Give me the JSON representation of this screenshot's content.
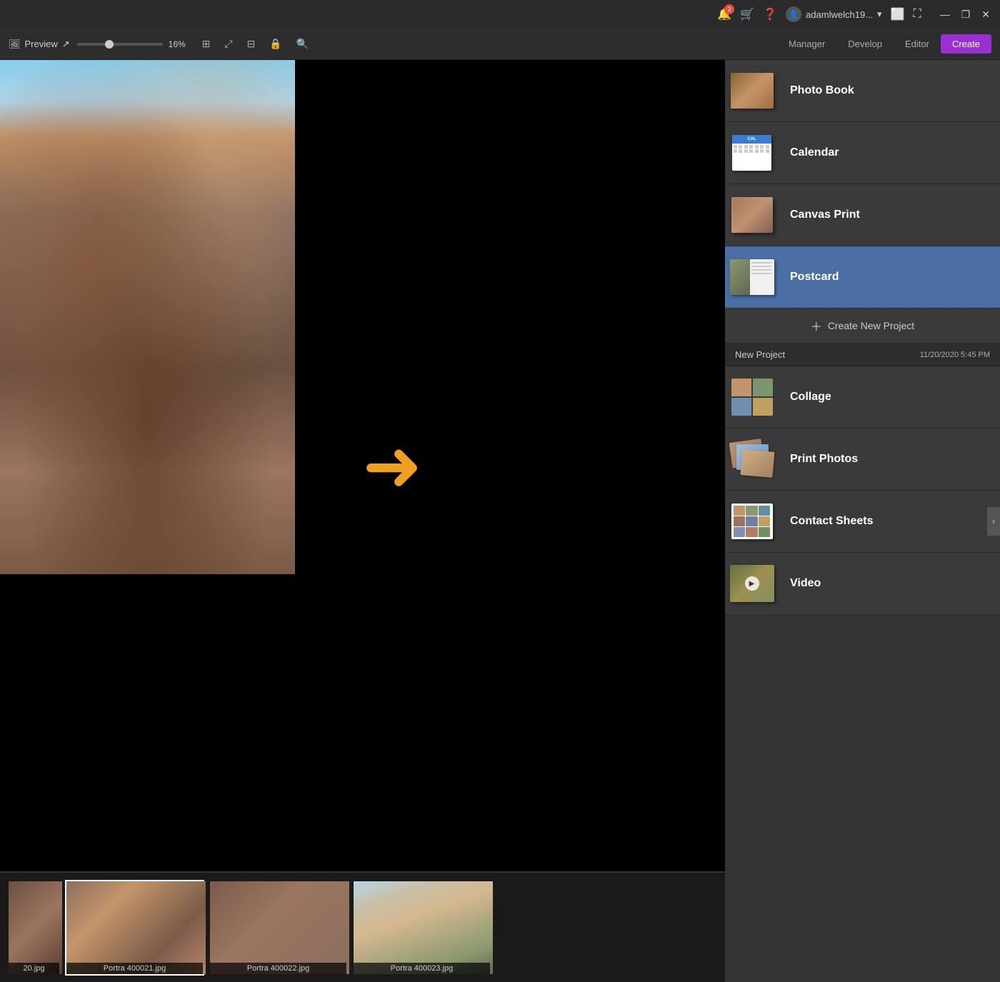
{
  "titlebar": {
    "notification_count": "2",
    "username": "adamlwelch19...",
    "monitor_icon": "⬜",
    "fullscreen_icon": "⛶",
    "minimize": "—",
    "restore": "❐",
    "close": "✕"
  },
  "toolbar": {
    "preview_label": "Preview",
    "zoom_percent": "16%",
    "nav": {
      "manager": "Manager",
      "develop": "Develop",
      "editor": "Editor",
      "create": "Create"
    }
  },
  "create_panel": {
    "items": [
      {
        "id": "photo-book",
        "label": "Photo Book",
        "active": false
      },
      {
        "id": "calendar",
        "label": "Calendar",
        "active": false
      },
      {
        "id": "canvas-print",
        "label": "Canvas Print",
        "active": false
      },
      {
        "id": "postcard",
        "label": "Postcard",
        "active": true
      },
      {
        "id": "collage",
        "label": "Collage",
        "active": false
      },
      {
        "id": "print-photos",
        "label": "Print Photos",
        "active": false
      },
      {
        "id": "contact-sheets",
        "label": "Contact Sheets",
        "active": false
      },
      {
        "id": "video",
        "label": "Video",
        "active": false
      }
    ],
    "create_new_label": "Create New Project",
    "project": {
      "name": "New Project",
      "date": "11/20/2020 5:45 PM"
    }
  },
  "filmstrip": {
    "items": [
      {
        "label": "20.jpg",
        "type": "rock1",
        "small": true
      },
      {
        "label": "Portra 400021.jpg",
        "type": "rock2",
        "selected": true
      },
      {
        "label": "Portra 400022.jpg",
        "type": "rock3"
      },
      {
        "label": "Portra 400023.jpg",
        "type": "rock4"
      }
    ]
  }
}
